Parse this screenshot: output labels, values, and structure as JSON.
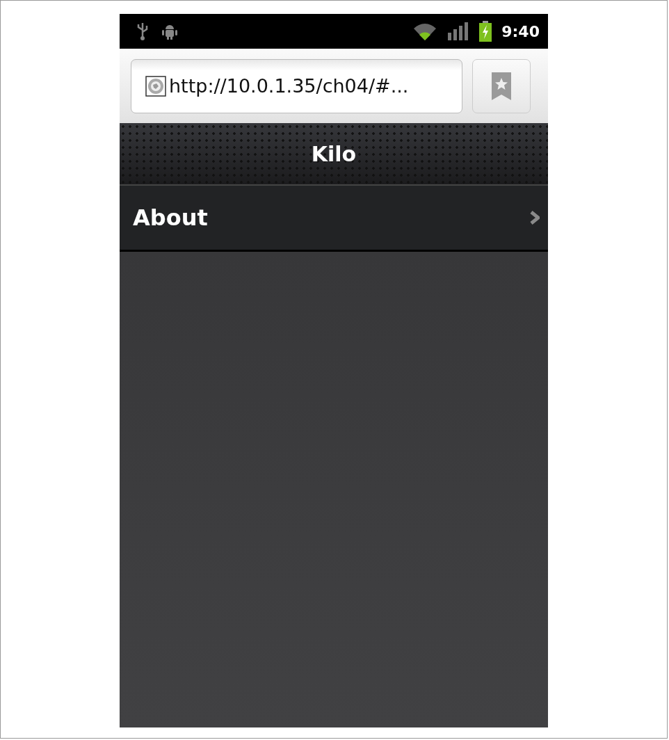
{
  "status_bar": {
    "time": "9:40"
  },
  "address_bar": {
    "url": "http://10.0.1.35/ch04/#..."
  },
  "toolbar": {
    "title": "Kilo"
  },
  "menu_items": [
    {
      "label": "About"
    }
  ]
}
